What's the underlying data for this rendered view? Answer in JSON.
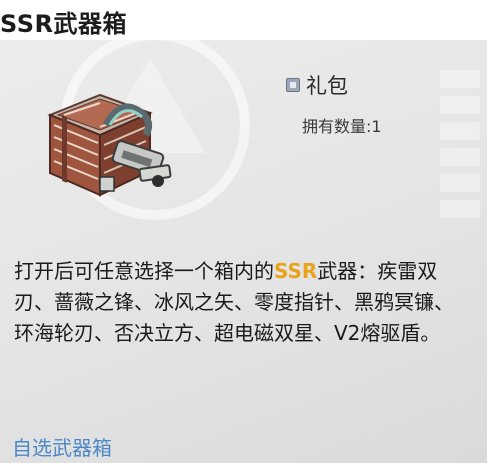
{
  "item": {
    "name": "SSR武器箱",
    "type_label": "礼包",
    "owned_label": "拥有数量:",
    "owned_count": "1",
    "description": {
      "part1": "打开后可任意选择一个箱内的",
      "highlight": "SSR",
      "part2": "武器：疾雷双刃、蔷薇之锋、冰风之矢、零度指针、黑鸦冥镰、环海轮刃、否决立方、超电磁双星、V2熔驱盾。"
    },
    "source_link": "自选武器箱"
  },
  "icons": {
    "type": "gift-type-icon",
    "item": "weapon-crate-icon"
  },
  "colors": {
    "highlight": "#e8a21b",
    "link": "#4a88c7",
    "card_bg": "#e6e6e6"
  }
}
